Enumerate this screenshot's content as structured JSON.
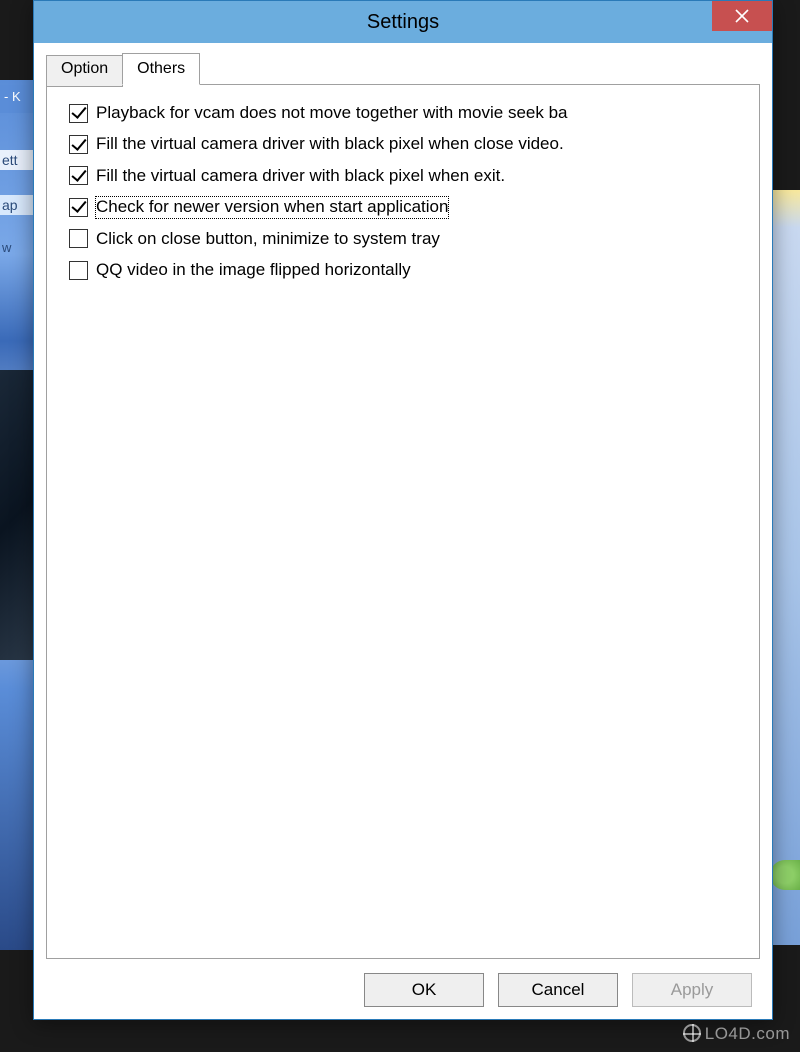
{
  "window": {
    "title": "Settings"
  },
  "tabs": [
    {
      "label": "Option",
      "active": false
    },
    {
      "label": "Others",
      "active": true
    }
  ],
  "options": [
    {
      "checked": true,
      "focused": false,
      "label": "Playback for vcam does not move together with movie seek ba"
    },
    {
      "checked": true,
      "focused": false,
      "label": "Fill the virtual camera driver with black pixel when close video."
    },
    {
      "checked": true,
      "focused": false,
      "label": "Fill the virtual camera driver with black pixel when exit."
    },
    {
      "checked": true,
      "focused": true,
      "label": "Check for newer version when start application"
    },
    {
      "checked": false,
      "focused": false,
      "label": "Click on close button, minimize to system tray"
    },
    {
      "checked": false,
      "focused": false,
      "label": "QQ video in the image flipped horizontally"
    }
  ],
  "buttons": {
    "ok": "OK",
    "cancel": "Cancel",
    "apply": "Apply"
  },
  "background": {
    "title_fragment": "- K",
    "text_ett": "ett",
    "text_ap": "ap",
    "text_w": "w"
  },
  "watermark": "LO4D.com"
}
